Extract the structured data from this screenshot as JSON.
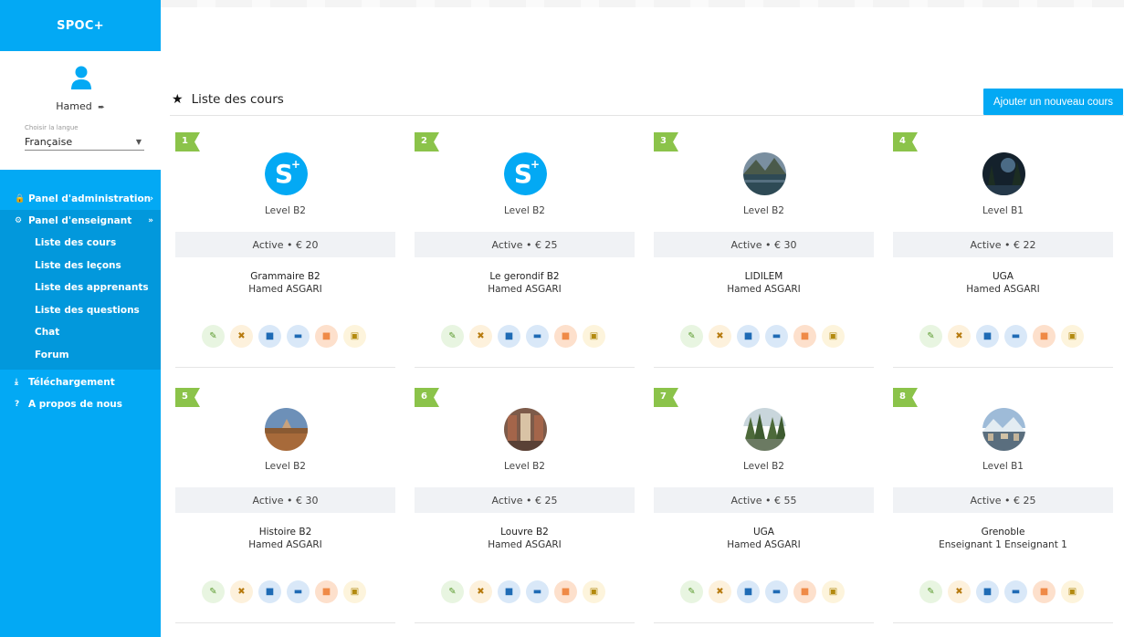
{
  "brand": "SPOC+",
  "user": {
    "name": "Hamed",
    "logout_icon": "logout-icon"
  },
  "language": {
    "label": "Choisir la langue",
    "value": "Française"
  },
  "menu": {
    "admin": "Panel d'administration",
    "teacher": "Panel d'enseignant",
    "sub": [
      "Liste des cours",
      "Liste des leçons",
      "Liste des apprenants",
      "Liste des questions",
      "Chat",
      "Forum"
    ],
    "download": "Téléchargement",
    "about": "A propos de nous"
  },
  "page": {
    "title": "Liste des cours",
    "add_button": "Ajouter un nouveau cours"
  },
  "colors": {
    "primary": "#03a9f4",
    "ribbon": "#8bc34a"
  },
  "courses": [
    {
      "num": "1",
      "level": "Level B2",
      "status": "Active • € 20",
      "name": "Grammaire B2",
      "teacher": "Hamed ASGARI",
      "thumb": "spoc-logo"
    },
    {
      "num": "2",
      "level": "Level B2",
      "status": "Active • € 25",
      "name": "Le gerondif B2",
      "teacher": "Hamed ASGARI",
      "thumb": "spoc-logo"
    },
    {
      "num": "3",
      "level": "Level B2",
      "status": "Active • € 30",
      "name": "LIDILEM",
      "teacher": "Hamed ASGARI",
      "thumb": "lake-mountain"
    },
    {
      "num": "4",
      "level": "Level B1",
      "status": "Active • € 22",
      "name": "UGA",
      "teacher": "Hamed ASGARI",
      "thumb": "night-forest"
    },
    {
      "num": "5",
      "level": "Level B2",
      "status": "Active • € 30",
      "name": "Histoire B2",
      "teacher": "Hamed ASGARI",
      "thumb": "louvre"
    },
    {
      "num": "6",
      "level": "Level B2",
      "status": "Active • € 25",
      "name": "Louvre B2",
      "teacher": "Hamed ASGARI",
      "thumb": "gallery"
    },
    {
      "num": "7",
      "level": "Level B2",
      "status": "Active • € 55",
      "name": "UGA",
      "teacher": "Hamed ASGARI",
      "thumb": "forest-river"
    },
    {
      "num": "8",
      "level": "Level B1",
      "status": "Active • € 25",
      "name": "Grenoble",
      "teacher": "Enseignant 1 Enseignant 1",
      "thumb": "city-mountains"
    }
  ]
}
